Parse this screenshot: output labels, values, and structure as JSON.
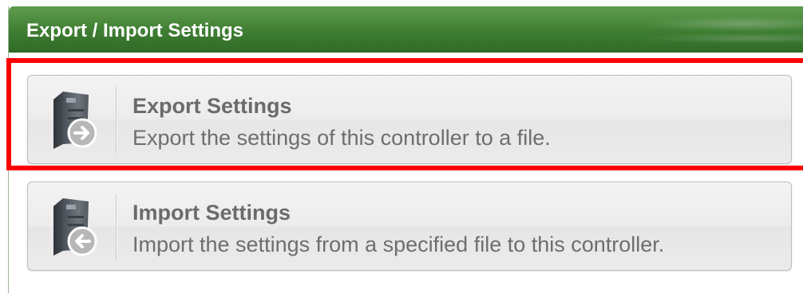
{
  "panel": {
    "title": "Export / Import Settings"
  },
  "actions": [
    {
      "title": "Export Settings",
      "description": "Export the settings of this controller to a file.",
      "icon": "controller-export-icon",
      "highlighted": true
    },
    {
      "title": "Import Settings",
      "description": "Import the settings from a specified file to this controller.",
      "icon": "controller-import-icon",
      "highlighted": false
    }
  ],
  "colors": {
    "header": "#3e7d32",
    "highlight": "#ff0000",
    "button_text": "#6b6b6b"
  }
}
